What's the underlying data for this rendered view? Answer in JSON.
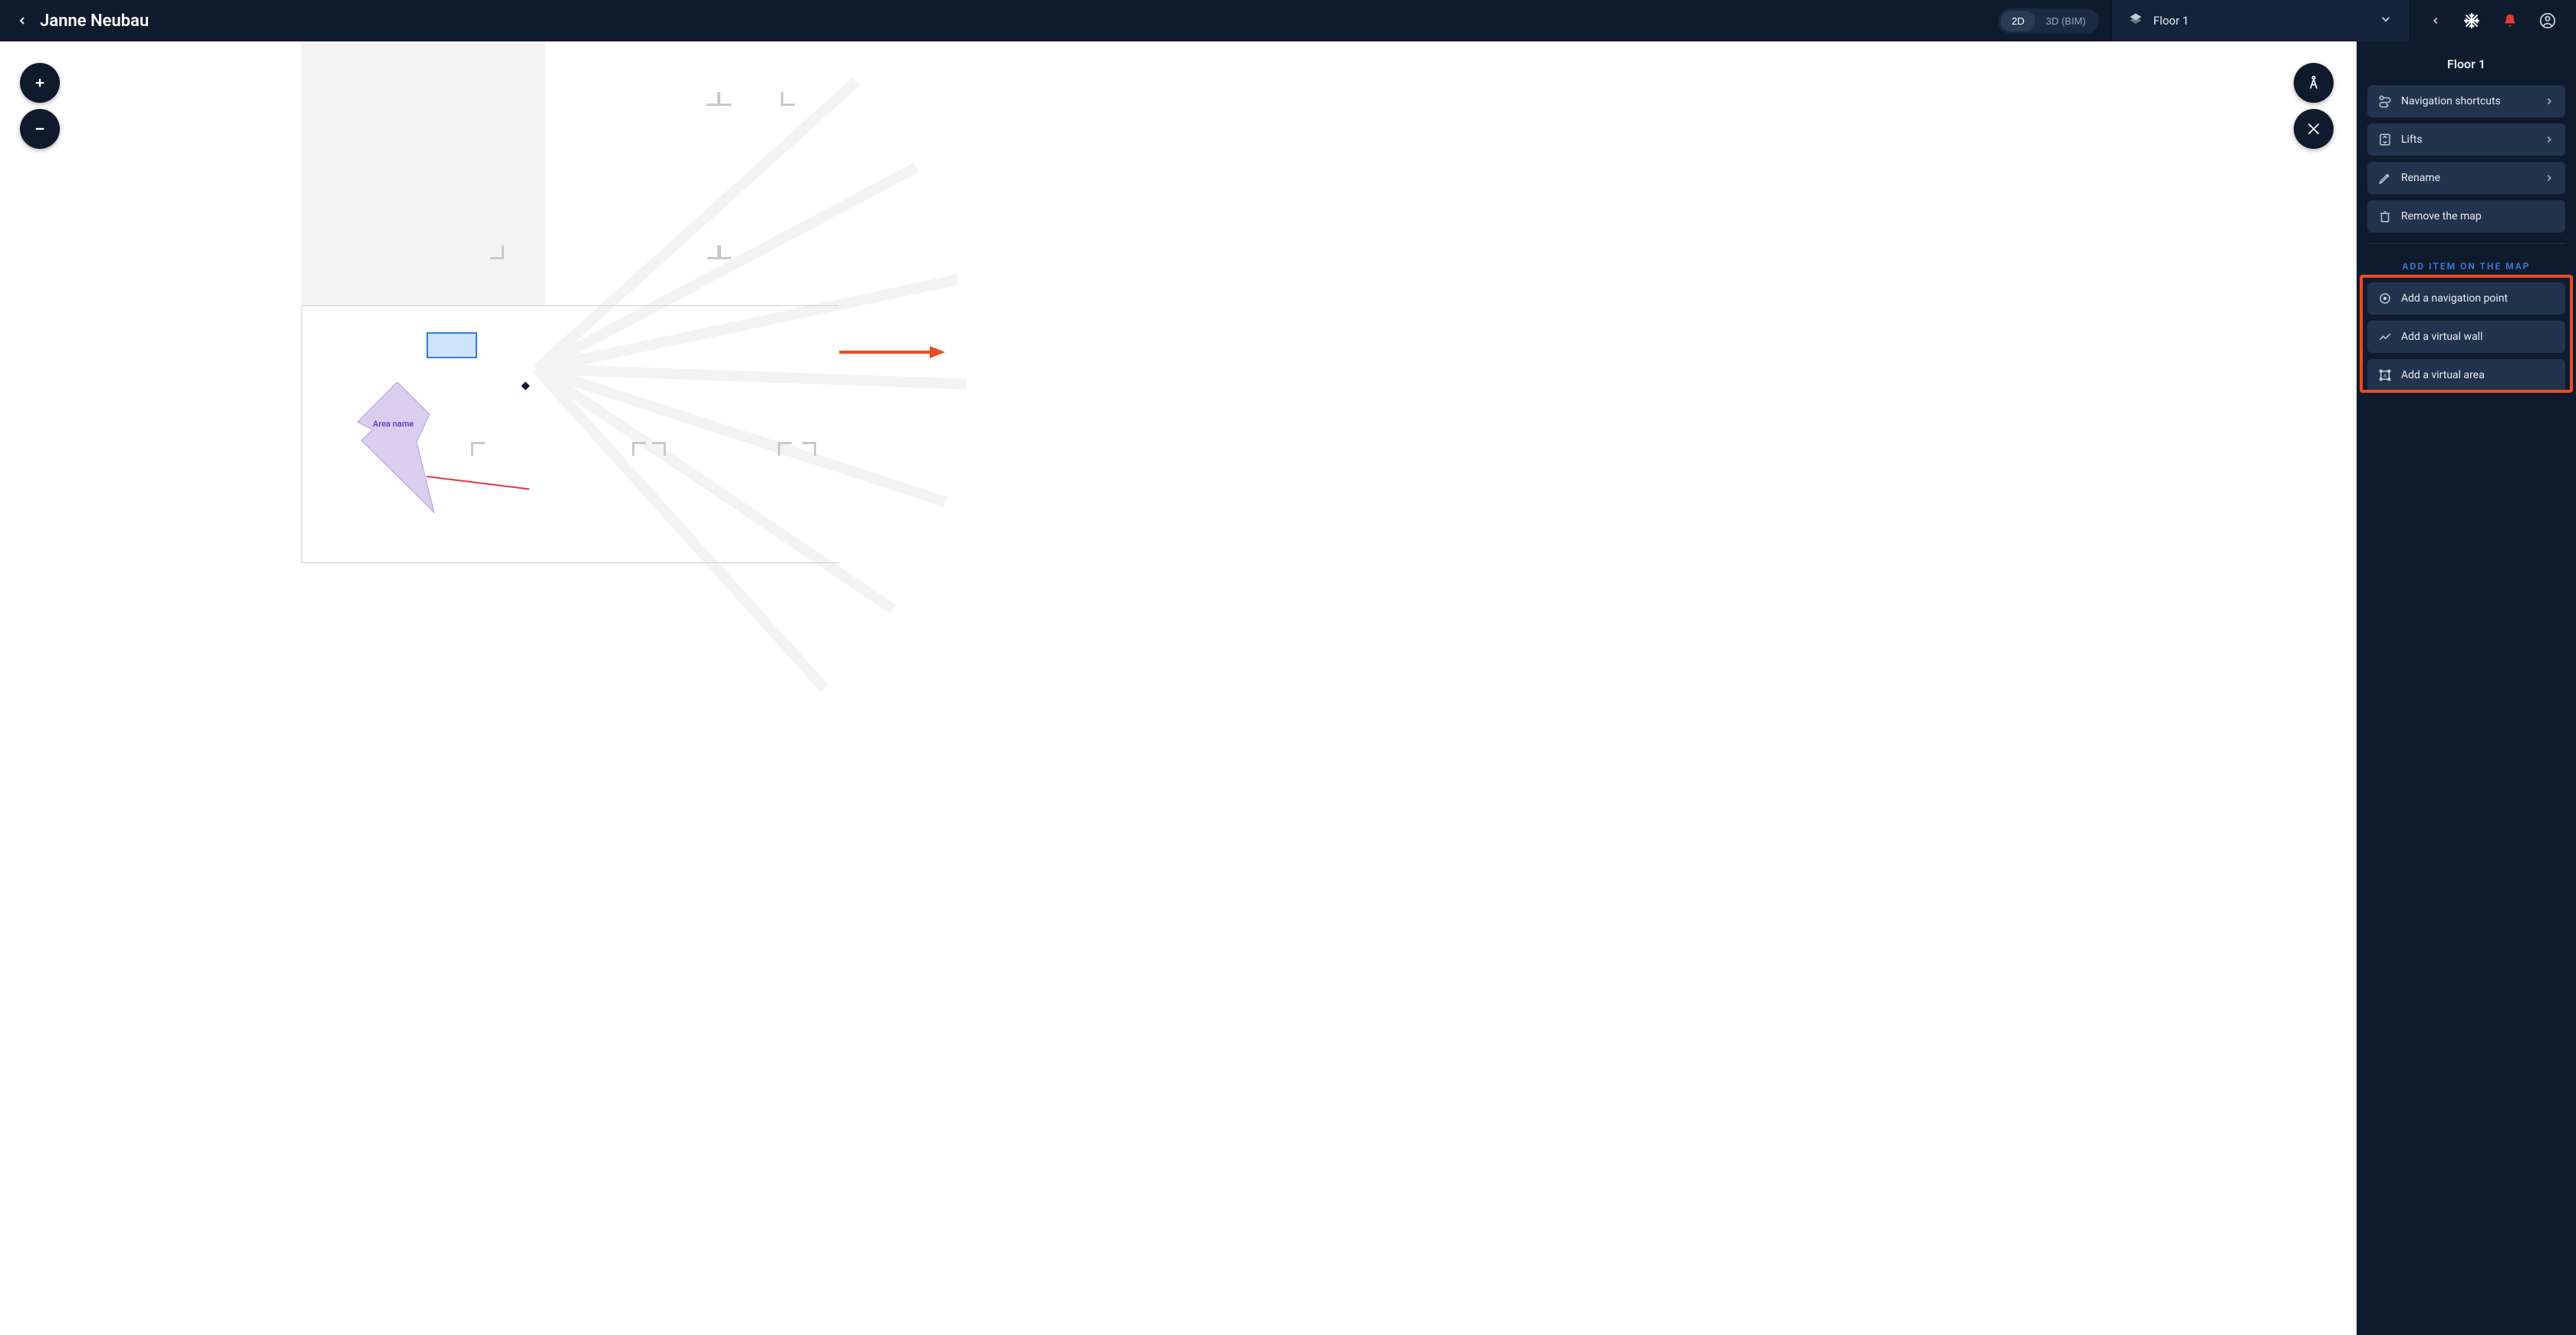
{
  "header": {
    "title": "Janne Neubau",
    "view2d": "2D",
    "view3d": "3D (BIM)",
    "floor_label": "Floor 1"
  },
  "map": {
    "area_label": "Area name"
  },
  "sidebar": {
    "title": "Floor 1",
    "items": [
      {
        "label": "Navigation shortcuts",
        "icon": "route",
        "chevron": true
      },
      {
        "label": "Lifts",
        "icon": "lift",
        "chevron": true
      },
      {
        "label": "Rename",
        "icon": "pencil",
        "chevron": true
      },
      {
        "label": "Remove the map",
        "icon": "trash",
        "chevron": false
      }
    ],
    "section_label": "ADD ITEM ON THE MAP",
    "add_items": [
      {
        "label": "Add a navigation point",
        "icon": "target"
      },
      {
        "label": "Add a virtual wall",
        "icon": "zigzag"
      },
      {
        "label": "Add a virtual area",
        "icon": "area"
      }
    ]
  },
  "colors": {
    "accent": "#3d7bd9",
    "danger": "#e53935",
    "highlight": "#eb4b22"
  }
}
